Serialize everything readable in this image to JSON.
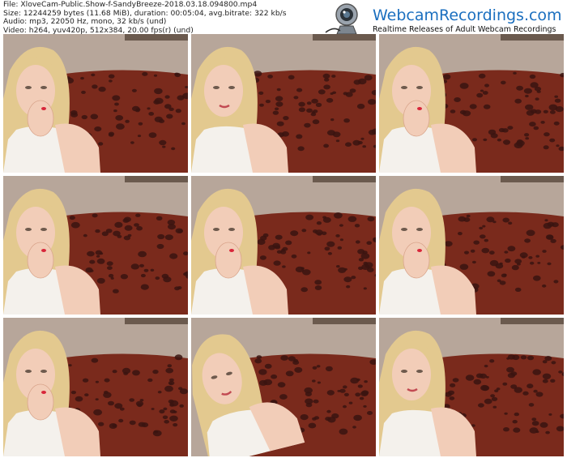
{
  "meta": {
    "file": "File: XloveCam-Public.Show-f-SandyBreeze-2018.03.18.094800.mp4",
    "size": "Size: 12244259 bytes (11.68 MiB), duration: 00:05:04, avg.bitrate: 322 kb/s",
    "audio": "Audio: mp3, 22050 Hz, mono, 32 kb/s (und)",
    "video": "Video: h264, yuv420p, 512x384, 20.00 fps(r) (und)"
  },
  "logo": {
    "title": "WebcamRecordings.com",
    "subtitle": "Realtime Releases of Adult Webcam Recordings",
    "icon": "webcam-icon"
  },
  "thumbnails": [
    {
      "index": 1,
      "pose": "hand-to-mouth"
    },
    {
      "index": 2,
      "pose": "looking-at-camera"
    },
    {
      "index": 3,
      "pose": "hand-to-mouth"
    },
    {
      "index": 4,
      "pose": "hand-to-mouth"
    },
    {
      "index": 5,
      "pose": "hand-to-mouth"
    },
    {
      "index": 6,
      "pose": "hand-to-mouth"
    },
    {
      "index": 7,
      "pose": "hand-to-mouth"
    },
    {
      "index": 8,
      "pose": "head-tilted"
    },
    {
      "index": 9,
      "pose": "looking-at-camera"
    }
  ],
  "colors": {
    "wall": "#b7a69a",
    "couch": "#7a2a1c",
    "spots": "#3a1410",
    "hair": "#e3c98f",
    "skin": "#f2cdb8",
    "top": "#f4f1ec",
    "logo_blue": "#1b6fbf"
  }
}
